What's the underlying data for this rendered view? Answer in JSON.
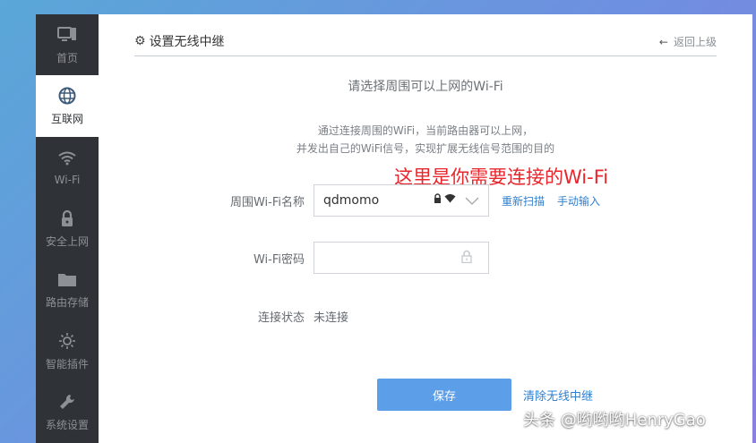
{
  "sidebar": {
    "items": [
      {
        "label": "首页",
        "icon": "monitor-icon",
        "glyph": "🖳",
        "active": false
      },
      {
        "label": "互联网",
        "icon": "globe-icon",
        "glyph": "◍",
        "active": true
      },
      {
        "label": "Wi-Fi",
        "icon": "wifi-icon",
        "glyph": "⌔",
        "active": false
      },
      {
        "label": "安全上网",
        "icon": "lock-icon",
        "glyph": "🔒",
        "active": false
      },
      {
        "label": "路由存储",
        "icon": "folder-icon",
        "glyph": "▰",
        "active": false
      },
      {
        "label": "智能插件",
        "icon": "bulb-icon",
        "glyph": "☼",
        "active": false
      },
      {
        "label": "系统设置",
        "icon": "wrench-icon",
        "glyph": "🔧",
        "active": false
      }
    ]
  },
  "header": {
    "title": "设置无线中继",
    "back_label": "返回上级"
  },
  "main": {
    "subtitle": "请选择周围可以上网的Wi-Fi",
    "desc_line1": "通过连接周围的WiFi，当前路由器可以上网，",
    "desc_line2": "并发出自己的WiFi信号，实现扩展无线信号范围的目的",
    "annotation": "这里是你需要连接的Wi-Fi"
  },
  "form": {
    "ssid_label": "周围Wi-Fi名称",
    "ssid_value": "qdmomo",
    "rescan_label": "重新扫描",
    "manual_label": "手动输入",
    "password_label": "Wi-Fi密码",
    "password_value": "",
    "status_label": "连接状态",
    "status_value": "未连接"
  },
  "actions": {
    "save_label": "保存",
    "clear_label": "清除无线中继"
  },
  "watermark": "头条 @哟哟哟HenryGao",
  "colors": {
    "sidebar_bg": "#2f3236",
    "primary_button": "#5d9ee8",
    "link": "#2f7fcf",
    "annotation": "#e8262b"
  }
}
